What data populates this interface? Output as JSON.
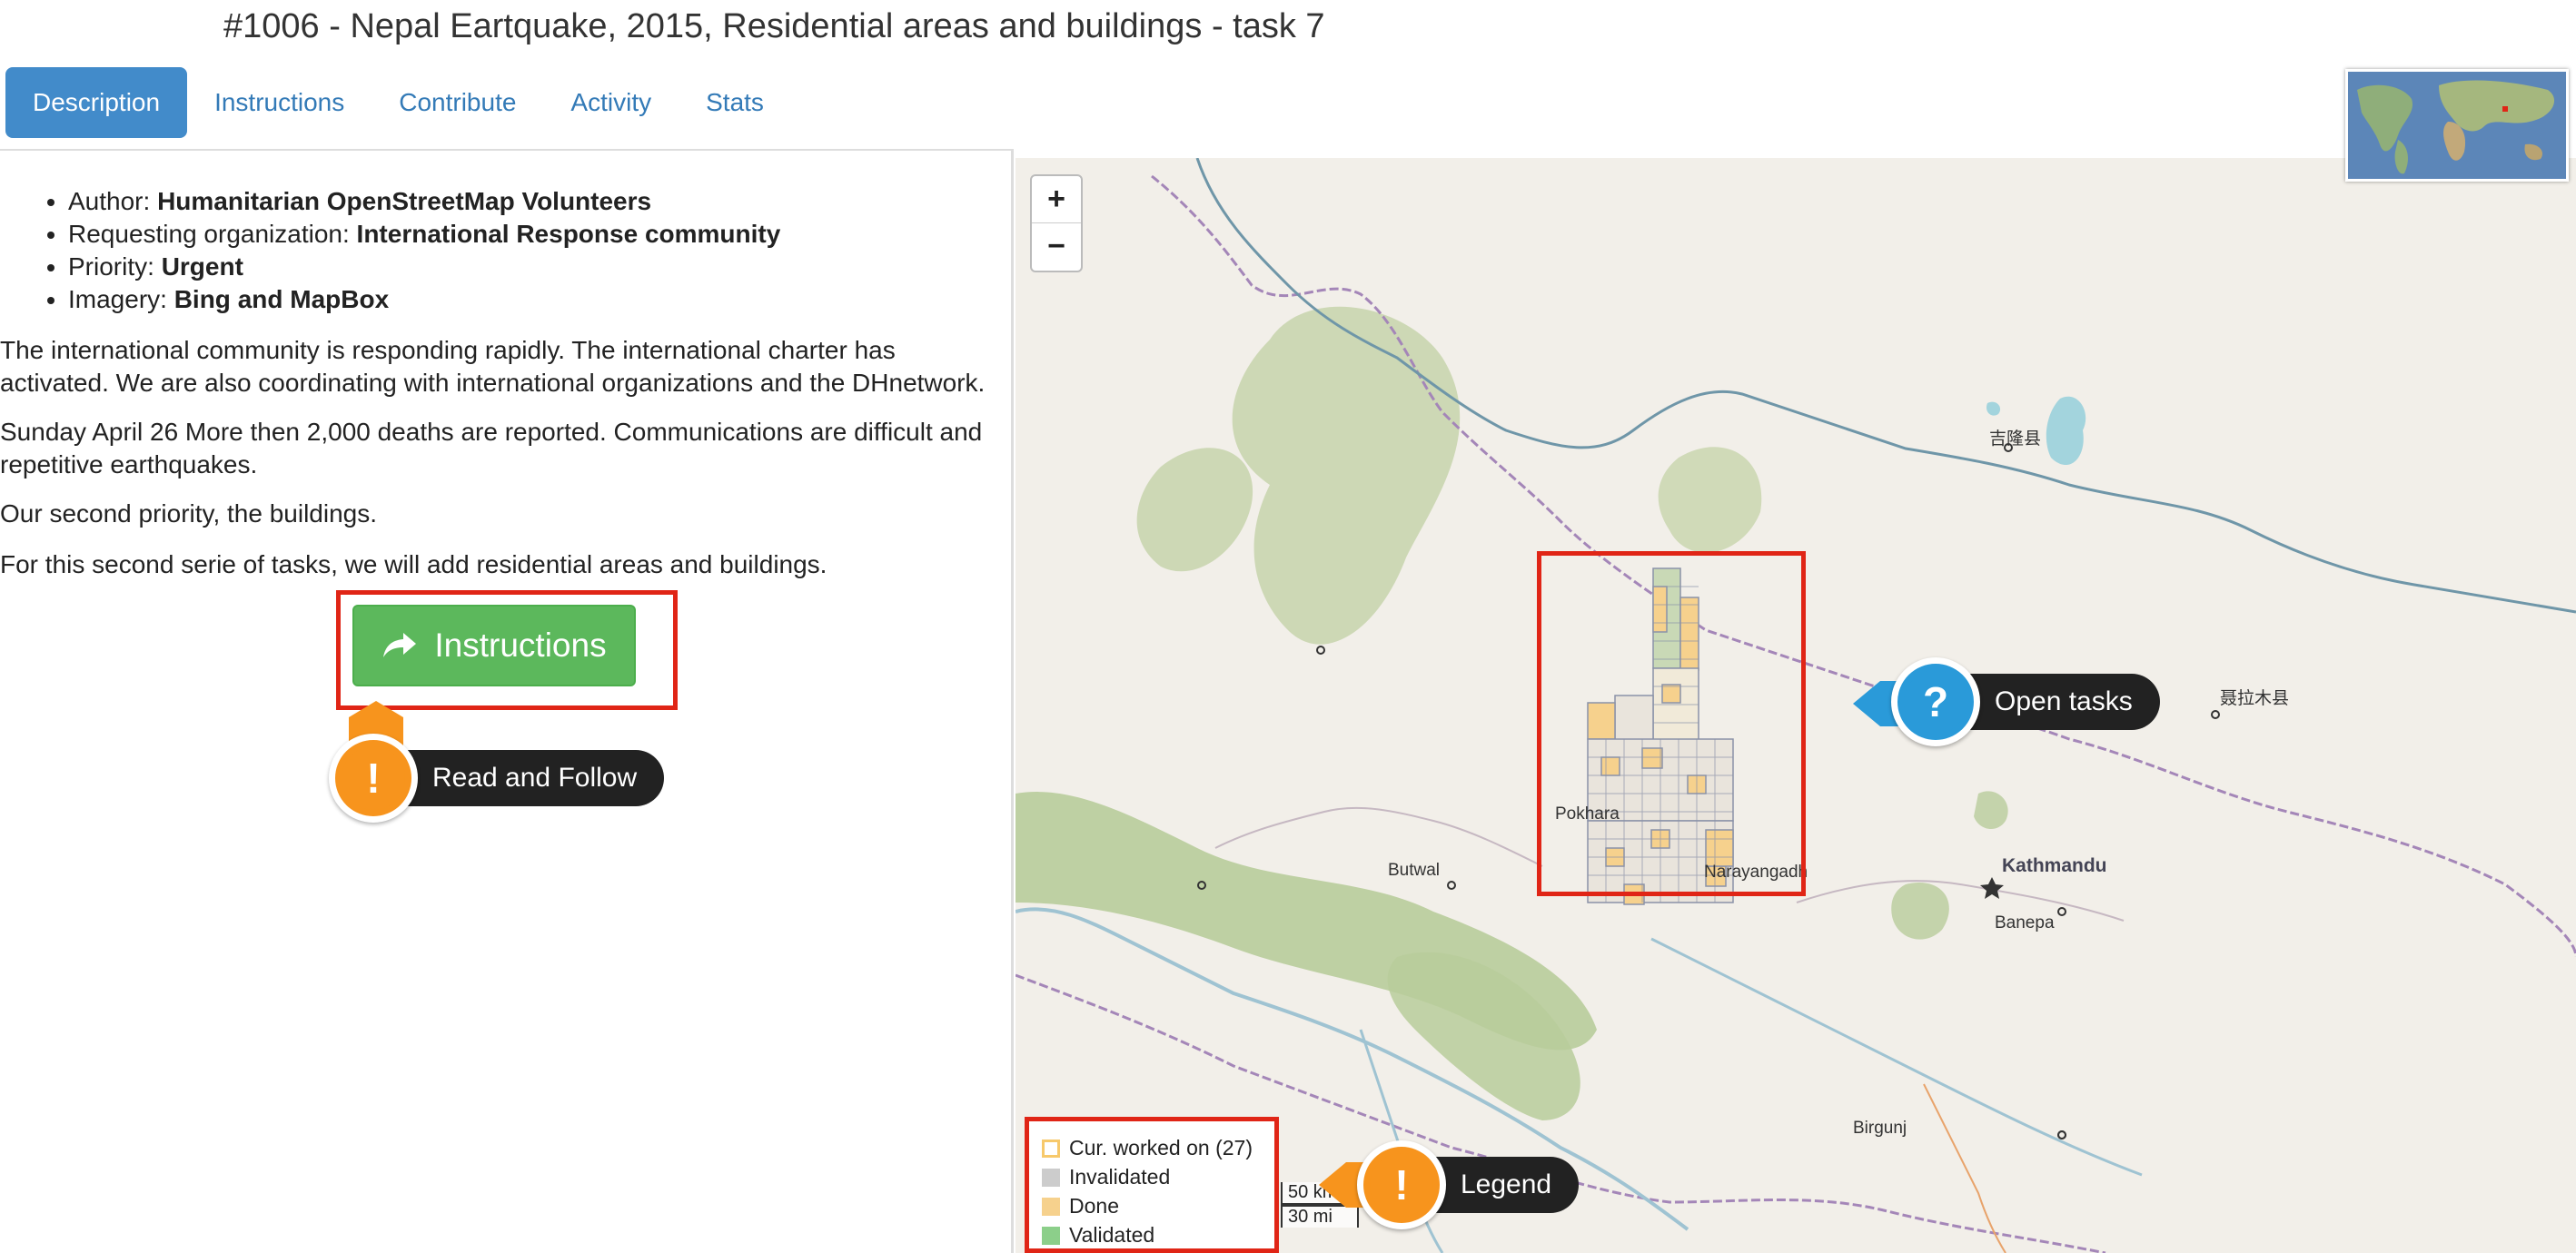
{
  "page": {
    "title": "#1006 - Nepal Eartquake, 2015, Residential areas and buildings - task 7"
  },
  "tabs": [
    {
      "label": "Description",
      "active": true
    },
    {
      "label": "Instructions",
      "active": false
    },
    {
      "label": "Contribute",
      "active": false
    },
    {
      "label": "Activity",
      "active": false
    },
    {
      "label": "Stats",
      "active": false
    }
  ],
  "description": {
    "meta": [
      {
        "label": "Author: ",
        "value": "Humanitarian OpenStreetMap Volunteers"
      },
      {
        "label": "Requesting organization: ",
        "value": "International Response community"
      },
      {
        "label": "Priority: ",
        "value": "Urgent"
      },
      {
        "label": "Imagery: ",
        "value": "Bing and MapBox"
      }
    ],
    "paragraphs": [
      "The international community is responding rapidly. The international charter has activated. We are also coordinating with international organizations and the DHnetwork.",
      "Sunday April 26 More then 2,000 deaths are reported. Communications are difficult and repetitive earthquakes.",
      "Our second priority, the buildings.",
      "For this second serie of tasks, we will add residential areas and buildings."
    ],
    "instructions_button": "Instructions"
  },
  "callouts": {
    "read": {
      "label": "Read and Follow",
      "glyph": "!",
      "color": "#f7941d"
    },
    "open": {
      "label": "Open tasks",
      "glyph": "?",
      "color": "#2a9ad9"
    },
    "legend": {
      "label": "Legend",
      "glyph": "!",
      "color": "#f7941d"
    }
  },
  "map": {
    "zoom_in": "+",
    "zoom_out": "−",
    "places": {
      "pokhara": "Pokhara",
      "butwal": "Butwal",
      "narayangadh": "Narayangadh",
      "kathmandu": "Kathmandu",
      "banepa": "Banepa",
      "birgunj": "Birgunj",
      "gyirong": "吉隆县",
      "nyalam": "聂拉木县"
    },
    "scale": {
      "km": "50 km",
      "mi": "30 mi"
    }
  },
  "legend": {
    "items": [
      {
        "label": "Cur. worked on (27)",
        "color": "#f7c96b",
        "type": "outline"
      },
      {
        "label": "Invalidated",
        "color": "#cccccc",
        "type": "fill"
      },
      {
        "label": "Done",
        "color": "#f6d18d",
        "type": "fill"
      },
      {
        "label": "Validated",
        "color": "#8ccf8a",
        "type": "fill"
      }
    ]
  },
  "icons": {
    "instructions_button": "share-arrow-icon",
    "read_callout": "exclamation-icon",
    "open_callout": "question-icon",
    "legend_callout": "exclamation-icon"
  }
}
